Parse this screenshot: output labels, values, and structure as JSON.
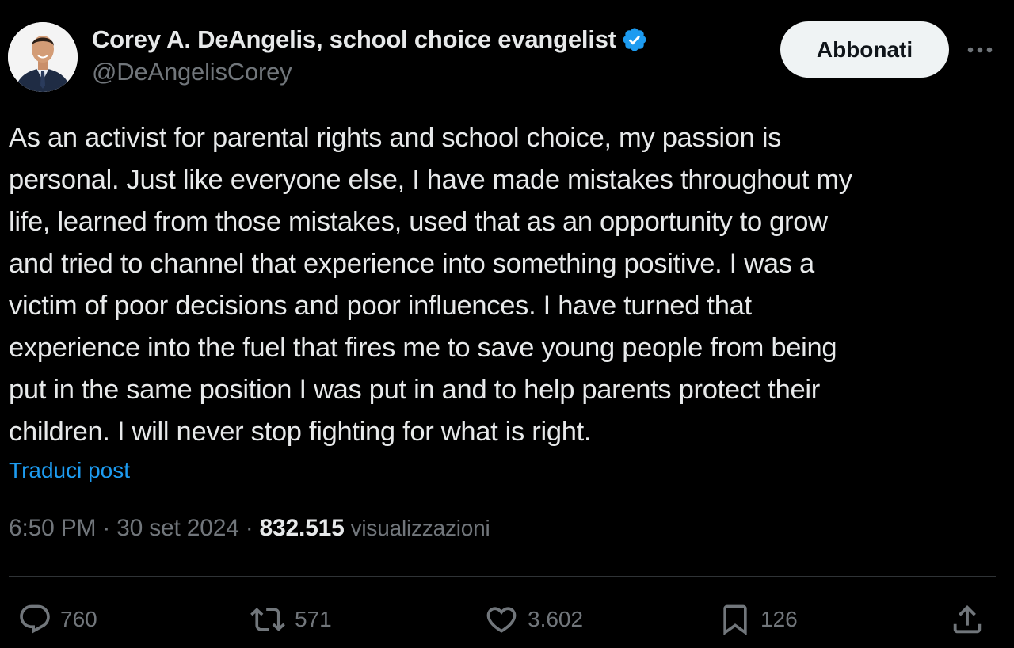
{
  "author": {
    "display_name": "Corey A. DeAngelis, school choice evangelist",
    "handle": "@DeAngelisCorey",
    "verified": true,
    "verified_color": "#1d9bf0"
  },
  "header": {
    "subscribe_label": "Abbonati",
    "more_icon": "more-horizontal-icon"
  },
  "post": {
    "text_lines": [
      "As an activist for parental rights and school choice, my passion is",
      "personal. Just like everyone else, I have made mistakes throughout my",
      "life, learned from those mistakes, used that as an opportunity to grow",
      "and tried to channel that experience into something positive. I was a",
      "victim of poor decisions and poor influences. I have turned that",
      "experience into the fuel that fires me to save young people from being",
      "put in the same position I was put in and to help parents protect their",
      "children. I will never stop fighting for what is right."
    ],
    "translate_label": "Traduci post"
  },
  "meta": {
    "time": "6:50 PM",
    "separator": "·",
    "date": "30 set 2024",
    "views_count": "832.515",
    "views_label": "visualizzazioni"
  },
  "actions": {
    "replies": {
      "icon": "reply-icon",
      "count": "760"
    },
    "reposts": {
      "icon": "repost-icon",
      "count": "571"
    },
    "likes": {
      "icon": "heart-icon",
      "count": "3.602"
    },
    "bookmarks": {
      "icon": "bookmark-icon",
      "count": "126"
    },
    "share": {
      "icon": "share-icon"
    }
  },
  "colors": {
    "background": "#000000",
    "text": "#e7e9ea",
    "secondary": "#71767b",
    "link": "#1d9bf0",
    "button_bg": "#eff3f4"
  }
}
